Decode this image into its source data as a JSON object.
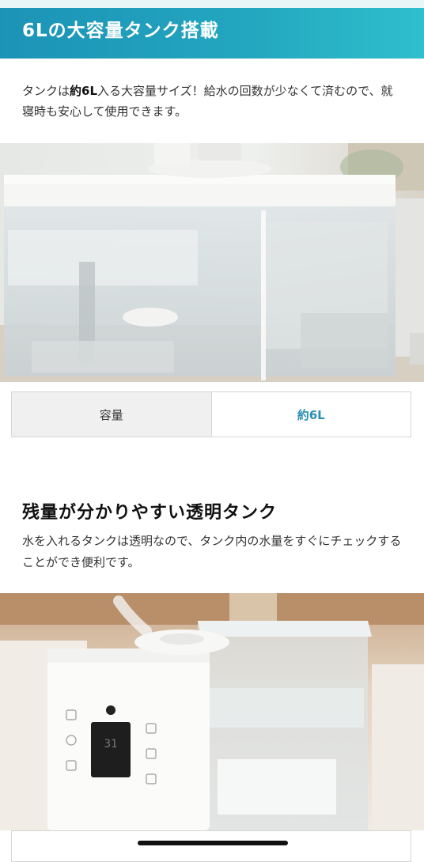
{
  "section1": {
    "title": "6Lの大容量タンク搭載",
    "intro_prefix": "タンクは",
    "intro_bold": "約6L",
    "intro_suffix": "入る大容量サイズ！給水の回数が少なくて済むので、就寝時も安心して使用できます。"
  },
  "spec": {
    "label": "容量",
    "value": "約6L"
  },
  "section2": {
    "title": "残量が分かりやすい透明タンク",
    "description": "水を入れるタンクは透明なので、タンク内の水量をすぐにチェックすることができ便利です。"
  },
  "humidifier_display": "31",
  "colors": {
    "banner_start": "#1c93b6",
    "banner_end": "#2fbfcd",
    "spec_value": "#2a8fb3"
  }
}
